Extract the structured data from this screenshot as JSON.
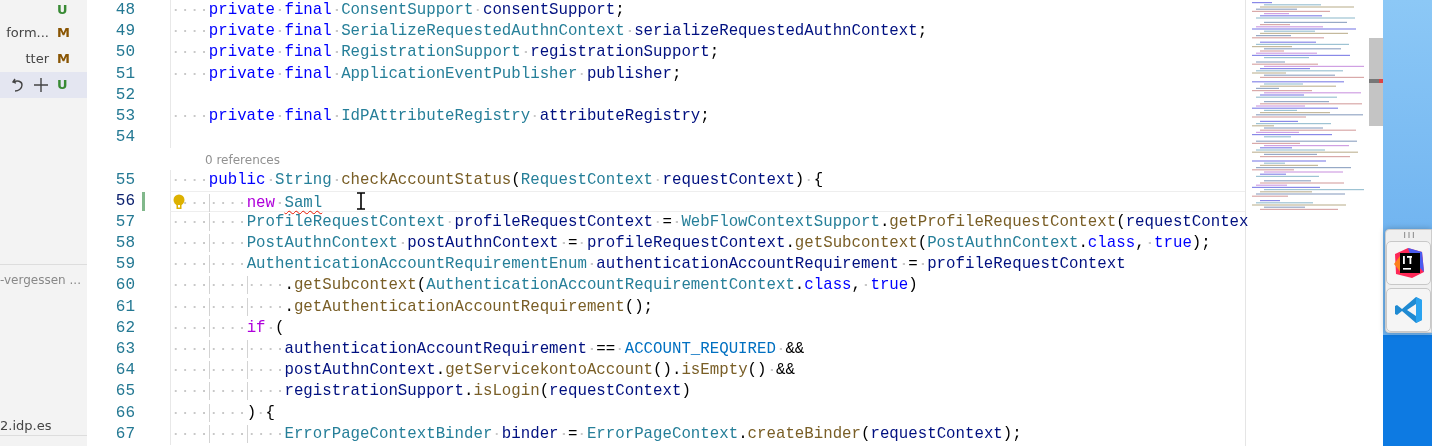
{
  "scm_panel": {
    "changes": [
      {
        "status": "U",
        "color": "#388a34",
        "selected": false
      },
      {
        "label": "form...",
        "status": "M",
        "color": "#895503",
        "selected": false
      },
      {
        "label": "tter",
        "status": "M",
        "color": "#895503",
        "selected": false
      },
      {
        "status": "U",
        "color": "#388a34",
        "selected": true
      }
    ],
    "section_label": "-vergessen ...",
    "footer_label": "2.idp.es"
  },
  "editor": {
    "lines": [
      {
        "kind": "code",
        "number": "48",
        "current": false,
        "modified": false,
        "lightbulb": false,
        "tokens": [
          {
            "kind": "keyword",
            "text": "    private "
          },
          {
            "kind": "keyword",
            "text": "final "
          },
          {
            "kind": "type",
            "text": "ConsentSupport "
          },
          {
            "kind": "variable",
            "text": "consentSupport"
          },
          {
            "kind": "punct",
            "text": ";"
          }
        ]
      },
      {
        "kind": "code",
        "number": "49",
        "current": false,
        "modified": false,
        "lightbulb": false,
        "tokens": [
          {
            "kind": "keyword",
            "text": "    private "
          },
          {
            "kind": "keyword",
            "text": "final "
          },
          {
            "kind": "type",
            "text": "SerializeRequestedAuthnContext "
          },
          {
            "kind": "variable",
            "text": "serializeRequestedAuthnContext"
          },
          {
            "kind": "punct",
            "text": ";"
          }
        ]
      },
      {
        "kind": "code",
        "number": "50",
        "current": false,
        "modified": false,
        "lightbulb": false,
        "tokens": [
          {
            "kind": "keyword",
            "text": "    private "
          },
          {
            "kind": "keyword",
            "text": "final "
          },
          {
            "kind": "type",
            "text": "RegistrationSupport "
          },
          {
            "kind": "variable",
            "text": "registrationSupport"
          },
          {
            "kind": "punct",
            "text": ";"
          }
        ]
      },
      {
        "kind": "code",
        "number": "51",
        "current": false,
        "modified": false,
        "lightbulb": false,
        "tokens": [
          {
            "kind": "keyword",
            "text": "    private "
          },
          {
            "kind": "keyword",
            "text": "final "
          },
          {
            "kind": "type",
            "text": "ApplicationEventPublisher "
          },
          {
            "kind": "variable",
            "text": "publisher"
          },
          {
            "kind": "punct",
            "text": ";"
          }
        ]
      },
      {
        "kind": "code",
        "number": "52",
        "current": false,
        "modified": false,
        "lightbulb": false
      },
      {
        "kind": "code",
        "number": "53",
        "current": false,
        "modified": false,
        "lightbulb": false,
        "tokens": [
          {
            "kind": "keyword",
            "text": "    private "
          },
          {
            "kind": "keyword",
            "text": "final "
          },
          {
            "kind": "type",
            "text": "IdPAttributeRegistry "
          },
          {
            "kind": "variable",
            "text": "attributeRegistry"
          },
          {
            "kind": "punct",
            "text": ";"
          }
        ]
      },
      {
        "kind": "code",
        "number": "54",
        "current": false,
        "modified": false,
        "lightbulb": false
      },
      {
        "kind": "lens",
        "text": "0 references"
      },
      {
        "kind": "code",
        "number": "55",
        "current": false,
        "modified": false,
        "lightbulb": false,
        "tokens": [
          {
            "kind": "keyword",
            "text": "    public "
          },
          {
            "kind": "type",
            "text": "String "
          },
          {
            "kind": "function",
            "text": "checkAccountStatus"
          },
          {
            "kind": "punct",
            "text": "("
          },
          {
            "kind": "type",
            "text": "RequestContext "
          },
          {
            "kind": "variable",
            "text": "requestContext"
          },
          {
            "kind": "punct",
            "text": ") {"
          }
        ]
      },
      {
        "kind": "code",
        "number": "56",
        "current": true,
        "modified": true,
        "lightbulb": true,
        "tokens": [
          {
            "kind": "control",
            "text": "        new "
          },
          {
            "kind": "error",
            "text": "Saml"
          }
        ]
      },
      {
        "kind": "code",
        "number": "57",
        "current": false,
        "modified": false,
        "lightbulb": false,
        "tokens": [
          {
            "kind": "type",
            "text": "        ProfileRequestContext "
          },
          {
            "kind": "variable",
            "text": "profileRequestContext"
          },
          {
            "kind": "punct",
            "text": " = "
          },
          {
            "kind": "type",
            "text": "WebFlowContextSupport"
          },
          {
            "kind": "punct",
            "text": "."
          },
          {
            "kind": "function",
            "text": "getProfileRequestContext"
          },
          {
            "kind": "punct",
            "text": "("
          },
          {
            "kind": "variable",
            "text": "requestContex"
          }
        ]
      },
      {
        "kind": "code",
        "number": "58",
        "current": false,
        "modified": false,
        "lightbulb": false,
        "tokens": [
          {
            "kind": "type",
            "text": "        PostAuthnContext "
          },
          {
            "kind": "variable",
            "text": "postAuthnContext"
          },
          {
            "kind": "punct",
            "text": " = "
          },
          {
            "kind": "variable",
            "text": "profileRequestContext"
          },
          {
            "kind": "punct",
            "text": "."
          },
          {
            "kind": "function",
            "text": "getSubcontext"
          },
          {
            "kind": "punct",
            "text": "("
          },
          {
            "kind": "type",
            "text": "PostAuthnContext"
          },
          {
            "kind": "punct",
            "text": "."
          },
          {
            "kind": "keyword",
            "text": "class"
          },
          {
            "kind": "punct",
            "text": ", "
          },
          {
            "kind": "keyword",
            "text": "true"
          },
          {
            "kind": "punct",
            "text": ");"
          }
        ]
      },
      {
        "kind": "code",
        "number": "59",
        "current": false,
        "modified": false,
        "lightbulb": false,
        "tokens": [
          {
            "kind": "type",
            "text": "        AuthenticationAccountRequirementEnum "
          },
          {
            "kind": "variable",
            "text": "authenticationAccountRequirement"
          },
          {
            "kind": "punct",
            "text": " = "
          },
          {
            "kind": "variable",
            "text": "profileRequestContext"
          }
        ]
      },
      {
        "kind": "code",
        "number": "60",
        "current": false,
        "modified": false,
        "lightbulb": false,
        "tokens": [
          {
            "kind": "punct",
            "text": "            ."
          },
          {
            "kind": "function",
            "text": "getSubcontext"
          },
          {
            "kind": "punct",
            "text": "("
          },
          {
            "kind": "type",
            "text": "AuthenticationAccountRequirementContext"
          },
          {
            "kind": "punct",
            "text": "."
          },
          {
            "kind": "keyword",
            "text": "class"
          },
          {
            "kind": "punct",
            "text": ", "
          },
          {
            "kind": "keyword",
            "text": "true"
          },
          {
            "kind": "punct",
            "text": ")"
          }
        ]
      },
      {
        "kind": "code",
        "number": "61",
        "current": false,
        "modified": false,
        "lightbulb": false,
        "tokens": [
          {
            "kind": "punct",
            "text": "            ."
          },
          {
            "kind": "function",
            "text": "getAuthenticationAccountRequirement"
          },
          {
            "kind": "punct",
            "text": "();"
          }
        ]
      },
      {
        "kind": "code",
        "number": "62",
        "current": false,
        "modified": false,
        "lightbulb": false,
        "tokens": [
          {
            "kind": "control",
            "text": "        if"
          },
          {
            "kind": "punct",
            "text": " ("
          }
        ]
      },
      {
        "kind": "code",
        "number": "63",
        "current": false,
        "modified": false,
        "lightbulb": false,
        "tokens": [
          {
            "kind": "variable",
            "text": "            authenticationAccountRequirement"
          },
          {
            "kind": "punct",
            "text": " == "
          },
          {
            "kind": "constant",
            "text": "ACCOUNT_REQUIRED"
          },
          {
            "kind": "punct",
            "text": " &&"
          }
        ]
      },
      {
        "kind": "code",
        "number": "64",
        "current": false,
        "modified": false,
        "lightbulb": false,
        "tokens": [
          {
            "kind": "variable",
            "text": "            postAuthnContext"
          },
          {
            "kind": "punct",
            "text": "."
          },
          {
            "kind": "function",
            "text": "getServicekontoAccount"
          },
          {
            "kind": "punct",
            "text": "()."
          },
          {
            "kind": "function",
            "text": "isEmpty"
          },
          {
            "kind": "punct",
            "text": "() &&"
          }
        ]
      },
      {
        "kind": "code",
        "number": "65",
        "current": false,
        "modified": false,
        "lightbulb": false,
        "tokens": [
          {
            "kind": "variable",
            "text": "            registrationSupport"
          },
          {
            "kind": "punct",
            "text": "."
          },
          {
            "kind": "function",
            "text": "isLogin"
          },
          {
            "kind": "punct",
            "text": "("
          },
          {
            "kind": "variable",
            "text": "requestContext"
          },
          {
            "kind": "punct",
            "text": ")"
          }
        ]
      },
      {
        "kind": "code",
        "number": "66",
        "current": false,
        "modified": false,
        "lightbulb": false,
        "tokens": [
          {
            "kind": "punct",
            "text": "        ) {"
          }
        ]
      },
      {
        "kind": "code",
        "number": "67",
        "current": false,
        "modified": false,
        "lightbulb": false,
        "tokens": [
          {
            "kind": "type",
            "text": "            ErrorPageContextBinder "
          },
          {
            "kind": "variable",
            "text": "binder"
          },
          {
            "kind": "punct",
            "text": " = "
          },
          {
            "kind": "type",
            "text": "ErrorPageContext"
          },
          {
            "kind": "punct",
            "text": "."
          },
          {
            "kind": "function",
            "text": "createBinder"
          },
          {
            "kind": "punct",
            "text": "("
          },
          {
            "kind": "variable",
            "text": "requestContext"
          },
          {
            "kind": "punct",
            "text": ");"
          }
        ]
      }
    ]
  }
}
